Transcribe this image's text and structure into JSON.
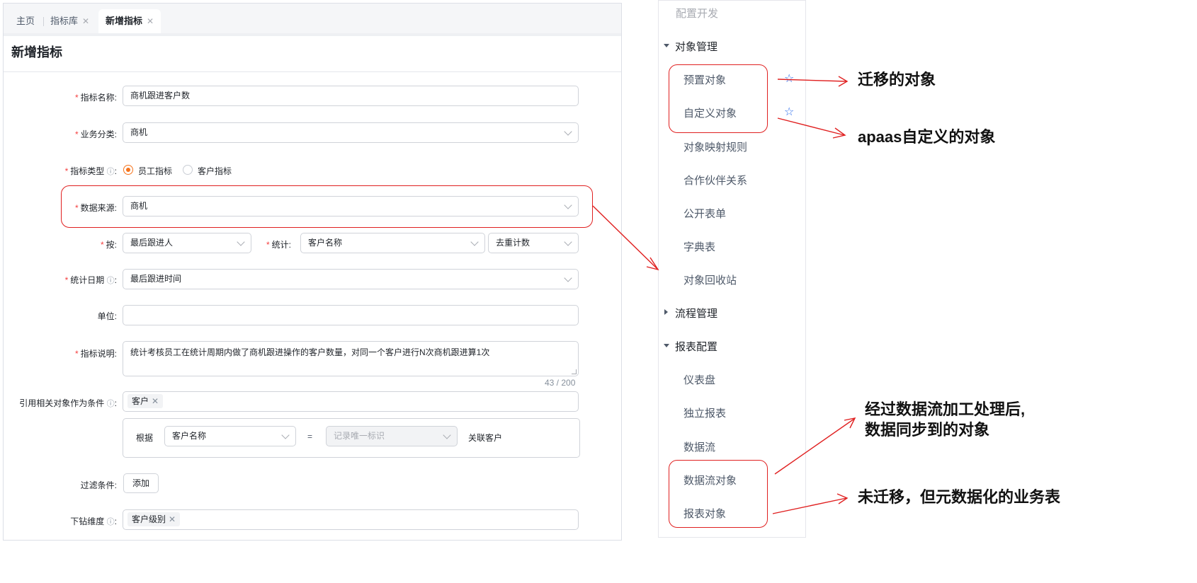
{
  "tabs": [
    {
      "label": "主页",
      "closable": false,
      "active": false
    },
    {
      "label": "指标库",
      "closable": true,
      "active": false
    },
    {
      "label": "新增指标",
      "closable": true,
      "active": true
    }
  ],
  "page_title": "新增指标",
  "form": {
    "metric_name": {
      "label": "指标名称:",
      "value": "商机跟进客户数"
    },
    "business_category": {
      "label": "业务分类:",
      "value": "商机"
    },
    "metric_type": {
      "label": "指标类型",
      "options": [
        "员工指标",
        "客户指标"
      ],
      "selected": "员工指标"
    },
    "data_source": {
      "label": "数据来源:",
      "value": "商机"
    },
    "by": {
      "label": "按:",
      "value": "最后跟进人"
    },
    "statistic": {
      "label": "统计:",
      "value": "客户名称",
      "method": "去重计数"
    },
    "stat_date": {
      "label": "统计日期",
      "value": "最后跟进时间"
    },
    "unit": {
      "label": "单位:",
      "value": ""
    },
    "description": {
      "label": "指标说明:",
      "value": "统计考核员工在统计周期内做了商机跟进操作的客户数量，对同一个客户进行N次商机跟进算1次",
      "counter": "43 / 200"
    },
    "related_condition": {
      "label": "引用相关对象作为条件",
      "tag": "客户",
      "basis_label": "根据",
      "basis_field": "客户名称",
      "equals": "=",
      "target_field_placeholder": "记录唯一标识",
      "link_label": "关联客户"
    },
    "filter": {
      "label": "过滤条件:",
      "button": "添加"
    },
    "drill_dimension": {
      "label": "下钻维度",
      "tag": "客户级别"
    },
    "colon": ":"
  },
  "sidebar": {
    "top_label": "配置开发",
    "groups": [
      {
        "title": "对象管理",
        "expanded": true,
        "items": [
          "预置对象",
          "自定义对象",
          "对象映射规则",
          "合作伙伴关系",
          "公开表单",
          "字典表",
          "对象回收站"
        ]
      },
      {
        "title": "流程管理",
        "expanded": false,
        "items": []
      },
      {
        "title": "报表配置",
        "expanded": true,
        "items": [
          "仪表盘",
          "独立报表",
          "数据流",
          "数据流对象",
          "报表对象"
        ]
      }
    ],
    "star_icon": "☆"
  },
  "annotations": {
    "migrated": "迁移的对象",
    "apaas_custom": "apaas自定义的对象",
    "dataflow_line1": "经过数据流加工处理后,",
    "dataflow_line2": "数据同步到的对象",
    "not_migrated": "未迁移，但元数据化的业务表",
    "color": "#e02020"
  },
  "colors": {
    "accent": "#f5731c",
    "required": "#f53f3f",
    "star": "#2f6fed"
  }
}
